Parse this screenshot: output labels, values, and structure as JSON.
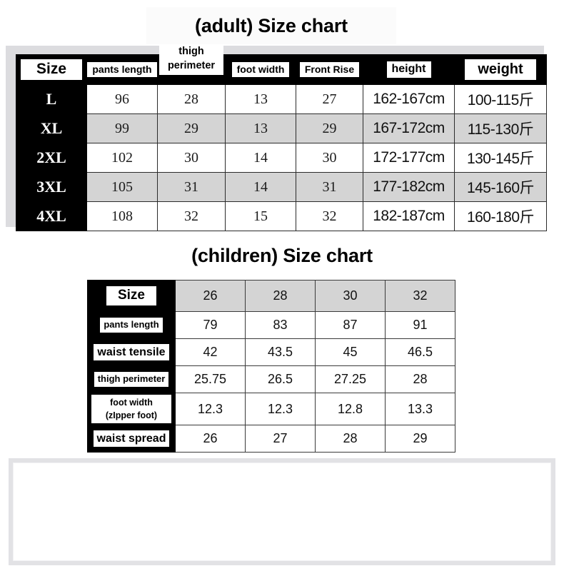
{
  "adult": {
    "title": "(adult) Size chart",
    "headers": [
      "Size",
      "pants length",
      "thigh perimeter",
      "foot width",
      "Front Rise",
      "height",
      "weight"
    ],
    "header_thigh_line1": "thigh",
    "header_thigh_line2": "perimeter",
    "rows": [
      {
        "size": "L",
        "pants_length": "96",
        "thigh_perimeter": "28",
        "foot_width": "13",
        "front_rise": "27",
        "height": "162-167cm",
        "weight": "100-115斤"
      },
      {
        "size": "XL",
        "pants_length": "99",
        "thigh_perimeter": "29",
        "foot_width": "13",
        "front_rise": "29",
        "height": "167-172cm",
        "weight": "115-130斤"
      },
      {
        "size": "2XL",
        "pants_length": "102",
        "thigh_perimeter": "30",
        "foot_width": "14",
        "front_rise": "30",
        "height": "172-177cm",
        "weight": "130-145斤"
      },
      {
        "size": "3XL",
        "pants_length": "105",
        "thigh_perimeter": "31",
        "foot_width": "14",
        "front_rise": "31",
        "height": "177-182cm",
        "weight": "145-160斤"
      },
      {
        "size": "4XL",
        "pants_length": "108",
        "thigh_perimeter": "32",
        "foot_width": "15",
        "front_rise": "32",
        "height": "182-187cm",
        "weight": "160-180斤"
      }
    ]
  },
  "children": {
    "title": "(children) Size chart",
    "size_label": "Size",
    "sizes": [
      "26",
      "28",
      "30",
      "32"
    ],
    "row_labels": [
      "pants length",
      "waist tensile",
      "thigh perimeter",
      "foot width (zIpper foot)",
      "waist spread"
    ],
    "foot_width_line1": "foot width",
    "foot_width_line2": "(zIpper foot)",
    "rows": [
      {
        "label": "pants length",
        "values": [
          "79",
          "83",
          "87",
          "91"
        ]
      },
      {
        "label": "waist tensile",
        "values": [
          "42",
          "43.5",
          "45",
          "46.5"
        ]
      },
      {
        "label": "thigh perimeter",
        "values": [
          "25.75",
          "26.5",
          "27.25",
          "28"
        ]
      },
      {
        "label": "foot width",
        "values": [
          "12.3",
          "12.3",
          "12.8",
          "13.3"
        ]
      },
      {
        "label": "waist spread",
        "values": [
          "26",
          "27",
          "28",
          "29"
        ]
      }
    ]
  },
  "colors": {
    "header_background": "#000000",
    "label_background": "#ffffff",
    "band_gray": "#dcdcdf",
    "row_stripe_gray": "#d4d4d4",
    "text_black": "#000000",
    "panel_border": "#e2e2e5"
  },
  "chart_data": {
    "type": "table",
    "title": "Size chart (adult and children)",
    "tables": [
      {
        "name": "adult",
        "title": "(adult) Size chart",
        "columns": [
          "Size",
          "pants length",
          "thigh perimeter",
          "foot width",
          "Front Rise",
          "height",
          "weight"
        ],
        "rows": [
          [
            "L",
            "96",
            "28",
            "13",
            "27",
            "162-167cm",
            "100-115斤"
          ],
          [
            "XL",
            "99",
            "29",
            "13",
            "29",
            "167-172cm",
            "115-130斤"
          ],
          [
            "2XL",
            "102",
            "30",
            "14",
            "30",
            "172-177cm",
            "130-145斤"
          ],
          [
            "3XL",
            "105",
            "31",
            "14",
            "31",
            "177-182cm",
            "145-160斤"
          ],
          [
            "4XL",
            "108",
            "32",
            "15",
            "32",
            "182-187cm",
            "160-180斤"
          ]
        ]
      },
      {
        "name": "children",
        "title": "(children) Size chart",
        "columns": [
          "Size",
          "26",
          "28",
          "30",
          "32"
        ],
        "rows": [
          [
            "pants length",
            "79",
            "83",
            "87",
            "91"
          ],
          [
            "waist tensile",
            "42",
            "43.5",
            "45",
            "46.5"
          ],
          [
            "thigh perimeter",
            "25.75",
            "26.5",
            "27.25",
            "28"
          ],
          [
            "foot width (zIpper foot)",
            "12.3",
            "12.3",
            "12.8",
            "13.3"
          ],
          [
            "waist spread",
            "26",
            "27",
            "28",
            "29"
          ]
        ]
      }
    ]
  }
}
